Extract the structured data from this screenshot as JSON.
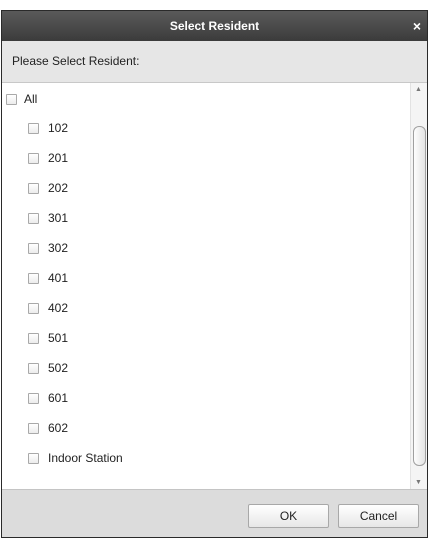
{
  "background_fragment": "",
  "dialog": {
    "title": "Select Resident",
    "close_glyph": "×",
    "prompt": "Please Select Resident:",
    "select_all_label": "All",
    "residents": [
      "102",
      "201",
      "202",
      "301",
      "302",
      "401",
      "402",
      "501",
      "502",
      "601",
      "602",
      "Indoor Station"
    ],
    "ok_label": "OK",
    "cancel_label": "Cancel"
  },
  "colors": {
    "titlebar": "#3b3b3b",
    "dialog_bg": "#f0f0f0",
    "footer_bg": "#dcdcdc"
  },
  "icons": {
    "close": "close-icon",
    "scroll_up": "scroll-up-arrow-icon",
    "scroll_down": "scroll-down-arrow-icon"
  }
}
